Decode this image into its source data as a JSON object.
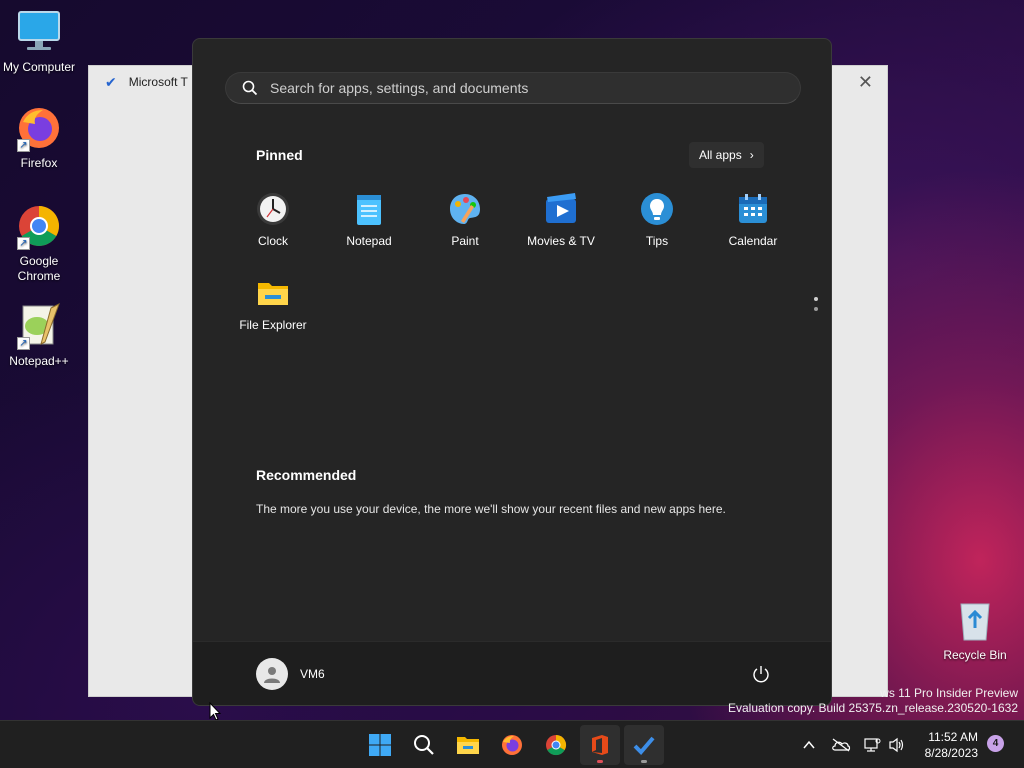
{
  "desktop": {
    "icons": [
      {
        "label": "My Computer",
        "icon": "computer-icon"
      },
      {
        "label": "Firefox",
        "icon": "firefox-icon"
      },
      {
        "label": "Google Chrome",
        "icon": "chrome-icon"
      },
      {
        "label": "Notepad++",
        "icon": "notepadpp-icon"
      },
      {
        "label": "Recycle Bin",
        "icon": "recycle-bin-icon"
      }
    ]
  },
  "background_window": {
    "title": "Microsoft T",
    "icon": "todo-check-icon"
  },
  "start_menu": {
    "search_placeholder": "Search for apps, settings, and documents",
    "pinned_title": "Pinned",
    "all_apps_label": "All apps",
    "pinned_apps": [
      {
        "label": "Clock",
        "icon": "clock-icon"
      },
      {
        "label": "Notepad",
        "icon": "notepad-icon"
      },
      {
        "label": "Paint",
        "icon": "paint-icon"
      },
      {
        "label": "Movies & TV",
        "icon": "movies-tv-icon"
      },
      {
        "label": "Tips",
        "icon": "tips-icon"
      },
      {
        "label": "Calendar",
        "icon": "calendar-icon"
      },
      {
        "label": "File Explorer",
        "icon": "file-explorer-icon"
      }
    ],
    "recommended_title": "Recommended",
    "recommended_text": "The more you use your device, the more we'll show your recent files and new apps here.",
    "user_name": "VM6"
  },
  "watermark": {
    "line1": "ws 11 Pro Insider Preview",
    "line2": "Evaluation copy. Build 25375.zn_release.230520-1632"
  },
  "taskbar": {
    "time": "11:52 AM",
    "date": "8/28/2023",
    "notification_count": "4",
    "apps": [
      "start-icon",
      "search-icon",
      "file-explorer-icon",
      "firefox-icon",
      "chrome-icon",
      "office-icon",
      "todo-icon"
    ]
  },
  "colors": {
    "accent": "#0078d4",
    "start_bg": "#252525",
    "taskbar_bg": "#202020"
  }
}
